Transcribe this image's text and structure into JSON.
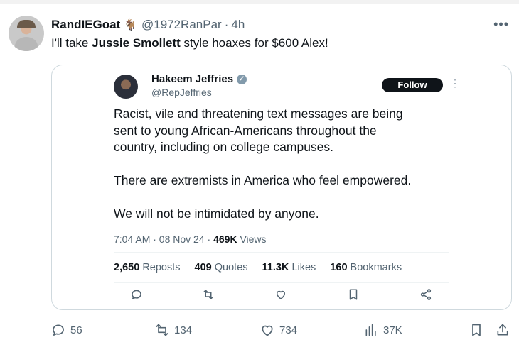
{
  "tweet": {
    "display_name": "RandIEGoat",
    "name_emoji": "🐐",
    "handle": "@1972RanPar",
    "time": "4h",
    "text_before": "I'll take ",
    "text_bold": "Jussie Smollett",
    "text_after": " style hoaxes for $600 Alex!"
  },
  "quoted": {
    "name": "Hakeem Jeffries",
    "handle": "@RepJeffries",
    "follow_label": "Follow",
    "paragraphs": [
      "Racist, vile and threatening text messages are being",
      "sent to young African-Americans throughout the",
      "country, including on college campuses.",
      "There are extremists in America who feel empowered.",
      "We will not be intimidated by anyone."
    ],
    "timestamp": "7:04 AM · 08 Nov 24",
    "views_count": "469K",
    "views_label": "Views",
    "stats": {
      "reposts_count": "2,650",
      "reposts_label": "Reposts",
      "quotes_count": "409",
      "quotes_label": "Quotes",
      "likes_count": "11.3K",
      "likes_label": "Likes",
      "bookmarks_count": "160",
      "bookmarks_label": "Bookmarks"
    }
  },
  "actions": {
    "replies": "56",
    "reposts": "134",
    "likes": "734",
    "views": "37K"
  },
  "icons": {
    "more": "more-icon",
    "verified": "verified-icon",
    "reply": "reply-icon",
    "repost": "repost-icon",
    "like": "heart-icon",
    "views": "analytics-icon",
    "bookmark": "bookmark-icon",
    "share": "share-icon"
  }
}
